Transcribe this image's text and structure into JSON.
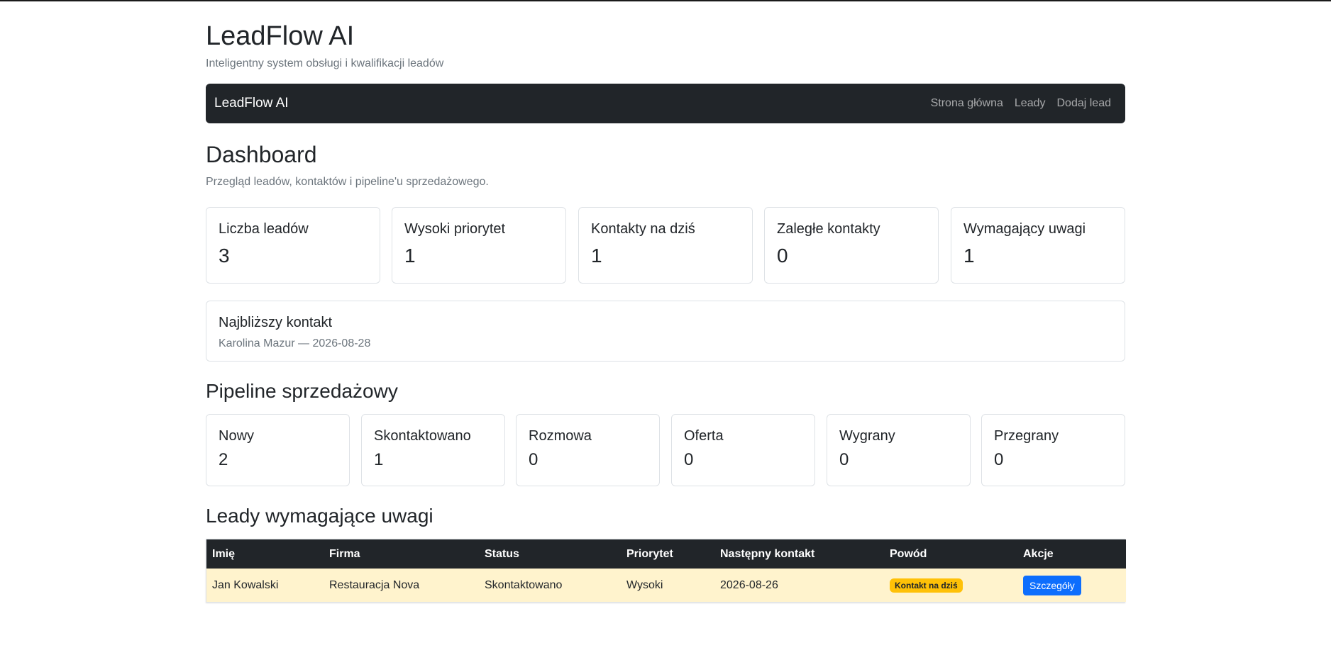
{
  "header": {
    "title": "LeadFlow AI",
    "subtitle": "Inteligentny system obsługi i kwalifikacji leadów"
  },
  "navbar": {
    "brand": "LeadFlow AI",
    "links": [
      "Strona główna",
      "Leady",
      "Dodaj lead"
    ]
  },
  "dashboard": {
    "title": "Dashboard",
    "lead": "Przegląd leadów, kontaktów i pipeline'u sprzedażowego."
  },
  "stats": [
    {
      "label": "Liczba leadów",
      "value": "3"
    },
    {
      "label": "Wysoki priorytet",
      "value": "1"
    },
    {
      "label": "Kontakty na dziś",
      "value": "1"
    },
    {
      "label": "Zaległe kontakty",
      "value": "0"
    },
    {
      "label": "Wymagający uwagi",
      "value": "1"
    }
  ],
  "next_contact": {
    "title": "Najbliższy kontakt",
    "text": "Karolina Mazur — 2026-08-28"
  },
  "pipeline": {
    "title": "Pipeline sprzedażowy",
    "stages": [
      {
        "label": "Nowy",
        "value": "2"
      },
      {
        "label": "Skontaktowano",
        "value": "1"
      },
      {
        "label": "Rozmowa",
        "value": "0"
      },
      {
        "label": "Oferta",
        "value": "0"
      },
      {
        "label": "Wygrany",
        "value": "0"
      },
      {
        "label": "Przegrany",
        "value": "0"
      }
    ]
  },
  "attention": {
    "title": "Leady wymagające uwagi",
    "columns": [
      "Imię",
      "Firma",
      "Status",
      "Priorytet",
      "Następny kontakt",
      "Powód",
      "Akcje"
    ],
    "rows": [
      {
        "name": "Jan Kowalski",
        "company": "Restauracja Nova",
        "status": "Skontaktowano",
        "priority": "Wysoki",
        "next_contact": "2026-08-26",
        "reason": "Kontakt na dziś",
        "action": "Szczegóły"
      }
    ]
  },
  "colors": {
    "navbar_bg": "#212529",
    "row_highlight": "#fff3cd",
    "badge_warning": "#ffc107",
    "button_primary": "#0d6efd"
  }
}
